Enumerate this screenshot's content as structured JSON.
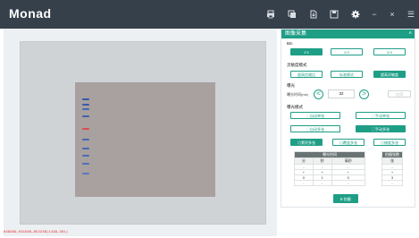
{
  "app": {
    "title": "Monad"
  },
  "titlebar": {
    "icons": [
      "printer-icon",
      "copy-icon",
      "export-icon",
      "save-icon",
      "settings-icon",
      "minimize-icon",
      "close-icon",
      "menu-icon"
    ],
    "minimize_glyph": "−",
    "close_glyph": "×",
    "menu_glyph": "☰"
  },
  "image": {
    "coords": "848959,031566,852236(1438,381)",
    "marker_colors": [
      "#3557a7",
      "#3a5aad",
      "#4568b5",
      "#3e61b0",
      "#e04b4b",
      "#4667b4",
      "#4869b6",
      "#4b6bb8",
      "#506fbb",
      "#5a78bf"
    ]
  },
  "panel": {
    "title": "图像采集",
    "collapse_glyph": "˄",
    "bin": {
      "label": "Bin",
      "options": [
        "1*1",
        "2*2",
        "3*3"
      ],
      "selected": "1*1"
    },
    "mode": {
      "label": "灵敏度模式",
      "options": [
        "超高信噪比",
        "标准模式",
        "超高灵敏度"
      ],
      "selected": "超高灵敏度"
    },
    "exposure": {
      "label": "曝光",
      "time_label": "曝光时间(ms)",
      "value": "32",
      "dec_glyph": "<",
      "inc_glyph": ">",
      "apply_label": "应用"
    },
    "capture_mode": {
      "label": "曝光模式",
      "options": [
        "自动单张",
        "手动单张",
        "自动多张",
        "手动多张"
      ],
      "selected": "手动多张",
      "multi_options": [
        "累积多张",
        "覆盖多张",
        "梯度多张"
      ],
      "multi_selected": "累积多张"
    },
    "table": {
      "group_header": "曝光时间",
      "count_header": "拍摄张数",
      "columns": [
        "分",
        "秒",
        "毫秒",
        "张"
      ],
      "rows": [
        [
          "-",
          "-",
          "-",
          "-"
        ],
        [
          "+",
          "+",
          "+",
          "+"
        ],
        [
          "0",
          "1",
          "0",
          "3"
        ],
        [
          "-",
          "-",
          "-",
          "-"
        ]
      ]
    },
    "capture_button": "拍摄"
  }
}
